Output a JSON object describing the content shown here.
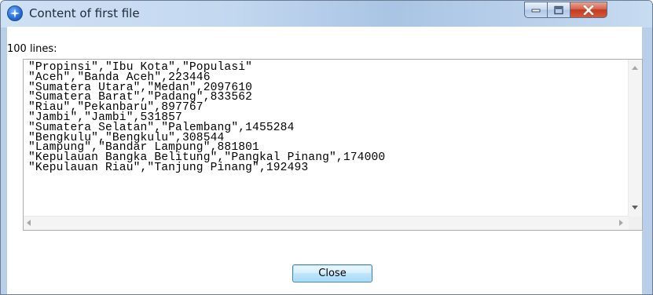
{
  "window": {
    "title": "Content of first file",
    "app_icon": "java-app-icon",
    "controls": [
      "minimize-icon",
      "maximize-icon",
      "close-icon"
    ]
  },
  "content": {
    "lines_label": "100 lines:",
    "text": "\"Propinsi\",\"Ibu Kota\",\"Populasi\"\n\"Aceh\",\"Banda Aceh\",223446\n\"Sumatera Utara\",\"Medan\",2097610\n\"Sumatera Barat\",\"Padang\",833562\n\"Riau\",\"Pekanbaru\",897767\n\"Jambi\",\"Jambi\",531857\n\"Sumatera Selatan\",\"Palembang\",1455284\n\"Bengkulu\",\"Bengkulu\",308544\n\"Lampung\",\"Bandar Lampung\",881801\n\"Kepulauan Bangka Belitung\",\"Pangkal Pinang\",174000\n\"Kepulauan Riau\",\"Tanjung Pinang\",192493"
  },
  "buttons": {
    "close_label": "Close"
  },
  "colors": {
    "close_button_accent": "#c23b20",
    "window_frame": "#b9cfe9"
  }
}
